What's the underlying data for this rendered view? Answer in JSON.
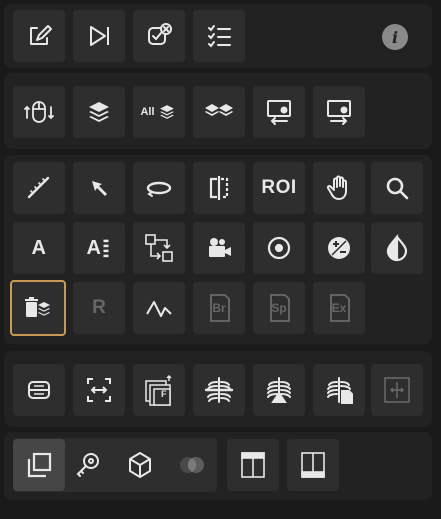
{
  "toolbar": {
    "row1": [
      "save-report-icon",
      "next-series-icon",
      "close-study-icon",
      "checklist-icon"
    ],
    "info_icon": "info-icon",
    "row2": [
      "scroll-mouse-icon",
      "layers-icon",
      "all-layers-icon",
      "stacked-layers-icon",
      "layout-import-icon",
      "layout-export-icon"
    ],
    "row3": [
      "ruler-icon",
      "arrow-pointer-icon",
      "rotate-icon",
      "flip-icon",
      "roi-label",
      "pan-hand-icon",
      "magnify-icon"
    ],
    "roi_label": "ROI",
    "row4": [
      "text-icon",
      "text-list-icon",
      "workflow-icon",
      "cine-camera-icon",
      "target-icon",
      "window-level-icon",
      "invert-icon"
    ],
    "text_label": "A",
    "text_list_label": "A",
    "all_label": "All",
    "row5": [
      "delete-layers-icon",
      "reset-label",
      "waveform-icon",
      "br-label",
      "sp-label",
      "ex-label"
    ],
    "reset_label": "R",
    "br_label": "Br",
    "sp_label": "Sp",
    "ex_label": "Ex",
    "row6": [
      "split-view-icon",
      "fit-view-icon",
      "frames-icon",
      "chest-split-icon",
      "chest-triangle-icon",
      "chest-document-icon",
      "expand-horizontal-icon"
    ],
    "frame_label": "F",
    "row7": [
      "stack-view-icon",
      "key-icon",
      "cube-icon",
      "fusion-icon",
      "layout-top-icon",
      "layout-bottom-icon"
    ]
  },
  "colors": {
    "background": "#1a1a1a",
    "panel": "#222222",
    "button": "#2e2e2e",
    "selected_border": "#c79a55",
    "icon": "#e8e8e8",
    "disabled": "#6a6a6a"
  }
}
